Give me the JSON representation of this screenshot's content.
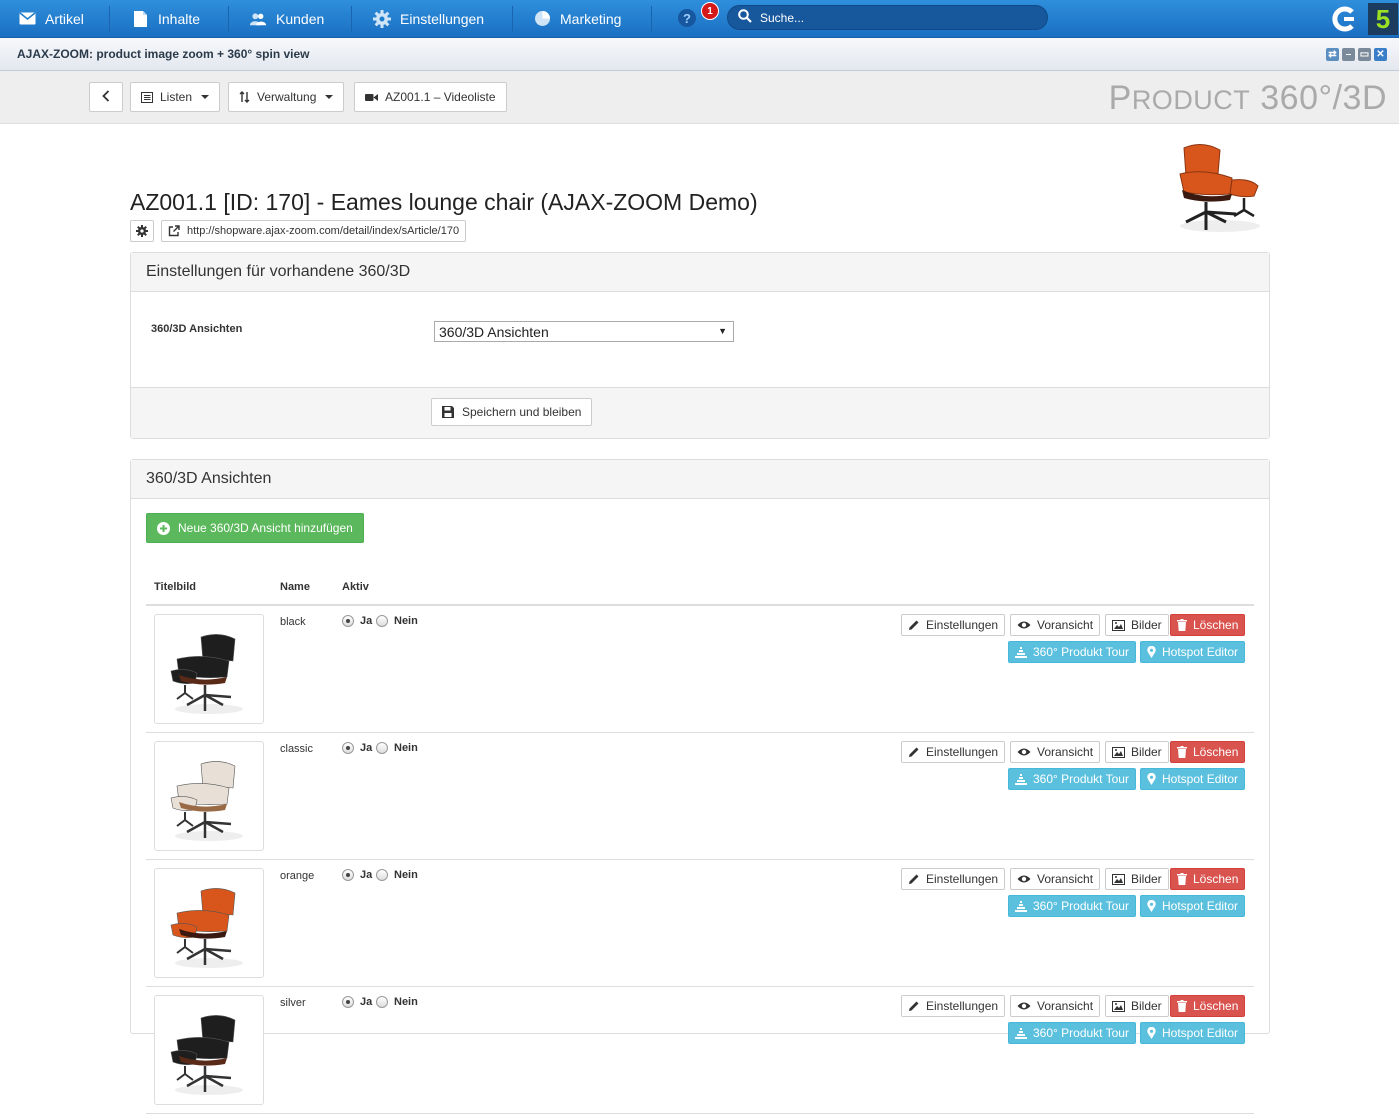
{
  "topbar": {
    "menu": [
      {
        "label": "Artikel",
        "icon": "envelope-icon"
      },
      {
        "label": "Inhalte",
        "icon": "document-icon"
      },
      {
        "label": "Kunden",
        "icon": "users-icon"
      },
      {
        "label": "Einstellungen",
        "icon": "gear-icon"
      },
      {
        "label": "Marketing",
        "icon": "pie-chart-icon"
      }
    ],
    "help": "?",
    "notifications": "1",
    "search_placeholder": "Suche...",
    "brand": "5"
  },
  "window": {
    "title": "AJAX-ZOOM: product image zoom + 360° spin view"
  },
  "toolbar": {
    "lists_label": "Listen",
    "admin_label": "Verwaltung",
    "video_label": "AZ001.1 – Videoliste",
    "product_title_big": "P",
    "product_title_small": "RODUCT",
    "product_title_rest": " 360°/3D"
  },
  "article": {
    "title": "AZ001.1 [ID: 170] - Eames lounge chair (AJAX-ZOOM Demo)",
    "url": "http://shopware.ajax-zoom.com/detail/index/sArticle/170"
  },
  "settings_panel": {
    "heading": "Einstellungen für vorhandene 360/3D",
    "field_label": "360/3D Ansichten",
    "select_value": "360/3D Ansichten",
    "save_label": "Speichern und bleiben"
  },
  "views_panel": {
    "heading": "360/3D Ansichten",
    "add_label": "Neue 360/3D Ansicht hinzufügen",
    "columns": [
      "Titelbild",
      "Name",
      "Aktiv"
    ],
    "yes_label": "Ja",
    "no_label": "Nein",
    "actions": {
      "settings": "Einstellungen",
      "preview": "Voransicht",
      "images": "Bilder",
      "delete": "Löschen",
      "tour": "360° Produkt Tour",
      "hotspot": "Hotspot Editor"
    },
    "rows": [
      {
        "name": "black",
        "active": true,
        "seat_color": "#1e1e1e",
        "shell_color": "#5a2a18"
      },
      {
        "name": "classic",
        "active": true,
        "seat_color": "#e8e0d6",
        "shell_color": "#9a6a44"
      },
      {
        "name": "orange",
        "active": true,
        "seat_color": "#d8561c",
        "shell_color": "#3a1a10"
      },
      {
        "name": "silver",
        "active": true,
        "seat_color": "#1e1e1e",
        "shell_color": "#5a2a18"
      }
    ]
  },
  "colors": {
    "topbar": "#1f7ccc",
    "green": "#5cb85c",
    "red": "#d9534f",
    "blue": "#5bc0de"
  }
}
